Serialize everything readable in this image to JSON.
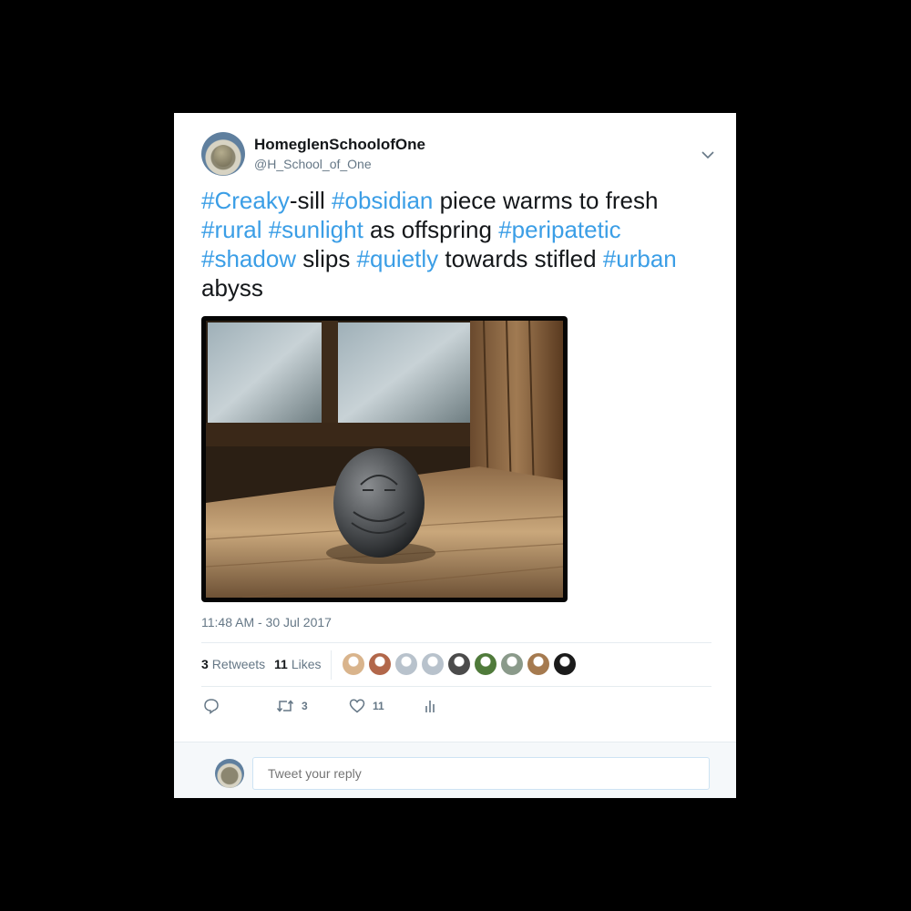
{
  "user": {
    "display_name": "HomeglenSchoolofOne",
    "handle": "@H_School_of_One"
  },
  "tweet": {
    "segments": [
      {
        "text": "#Creaky",
        "tag": true
      },
      {
        "text": "-sill ",
        "tag": false
      },
      {
        "text": "#obsidian",
        "tag": true
      },
      {
        "text": " piece warms to fresh ",
        "tag": false
      },
      {
        "text": "#rural",
        "tag": true
      },
      {
        "text": " ",
        "tag": false
      },
      {
        "text": "#sunlight",
        "tag": true
      },
      {
        "text": " as offspring ",
        "tag": false
      },
      {
        "text": "#peripatetic",
        "tag": true
      },
      {
        "text": " ",
        "tag": false
      },
      {
        "text": "#shadow",
        "tag": true
      },
      {
        "text": " slips ",
        "tag": false
      },
      {
        "text": "#quietly",
        "tag": true
      },
      {
        "text": " towards stifled ",
        "tag": false
      },
      {
        "text": "#urban",
        "tag": true
      },
      {
        "text": " abyss",
        "tag": false
      }
    ],
    "timestamp": "11:48 AM - 30 Jul 2017"
  },
  "stats": {
    "retweets_count": "3",
    "retweets_label": "Retweets",
    "likes_count": "11",
    "likes_label": "Likes"
  },
  "likers": [
    {
      "name": "liker-1",
      "color": "#d9b48c"
    },
    {
      "name": "liker-2",
      "color": "#b2674a"
    },
    {
      "name": "liker-3",
      "color": "#b8c2cc"
    },
    {
      "name": "liker-4",
      "color": "#b8c2cc"
    },
    {
      "name": "liker-5",
      "color": "#4b4b4b"
    },
    {
      "name": "liker-6",
      "color": "#4f7a3a"
    },
    {
      "name": "liker-7",
      "color": "#8a9a8a"
    },
    {
      "name": "liker-8",
      "color": "#a57a4f"
    },
    {
      "name": "liker-9",
      "color": "#1b1b1b"
    }
  ],
  "actions": {
    "reply_icon": "reply-icon",
    "retweet_count": "3",
    "like_count": "11",
    "analytics_icon": "analytics-icon"
  },
  "reply": {
    "placeholder": "Tweet your reply"
  },
  "colors": {
    "accent": "#3b9ee6",
    "text": "#14171a",
    "muted": "#657786"
  }
}
